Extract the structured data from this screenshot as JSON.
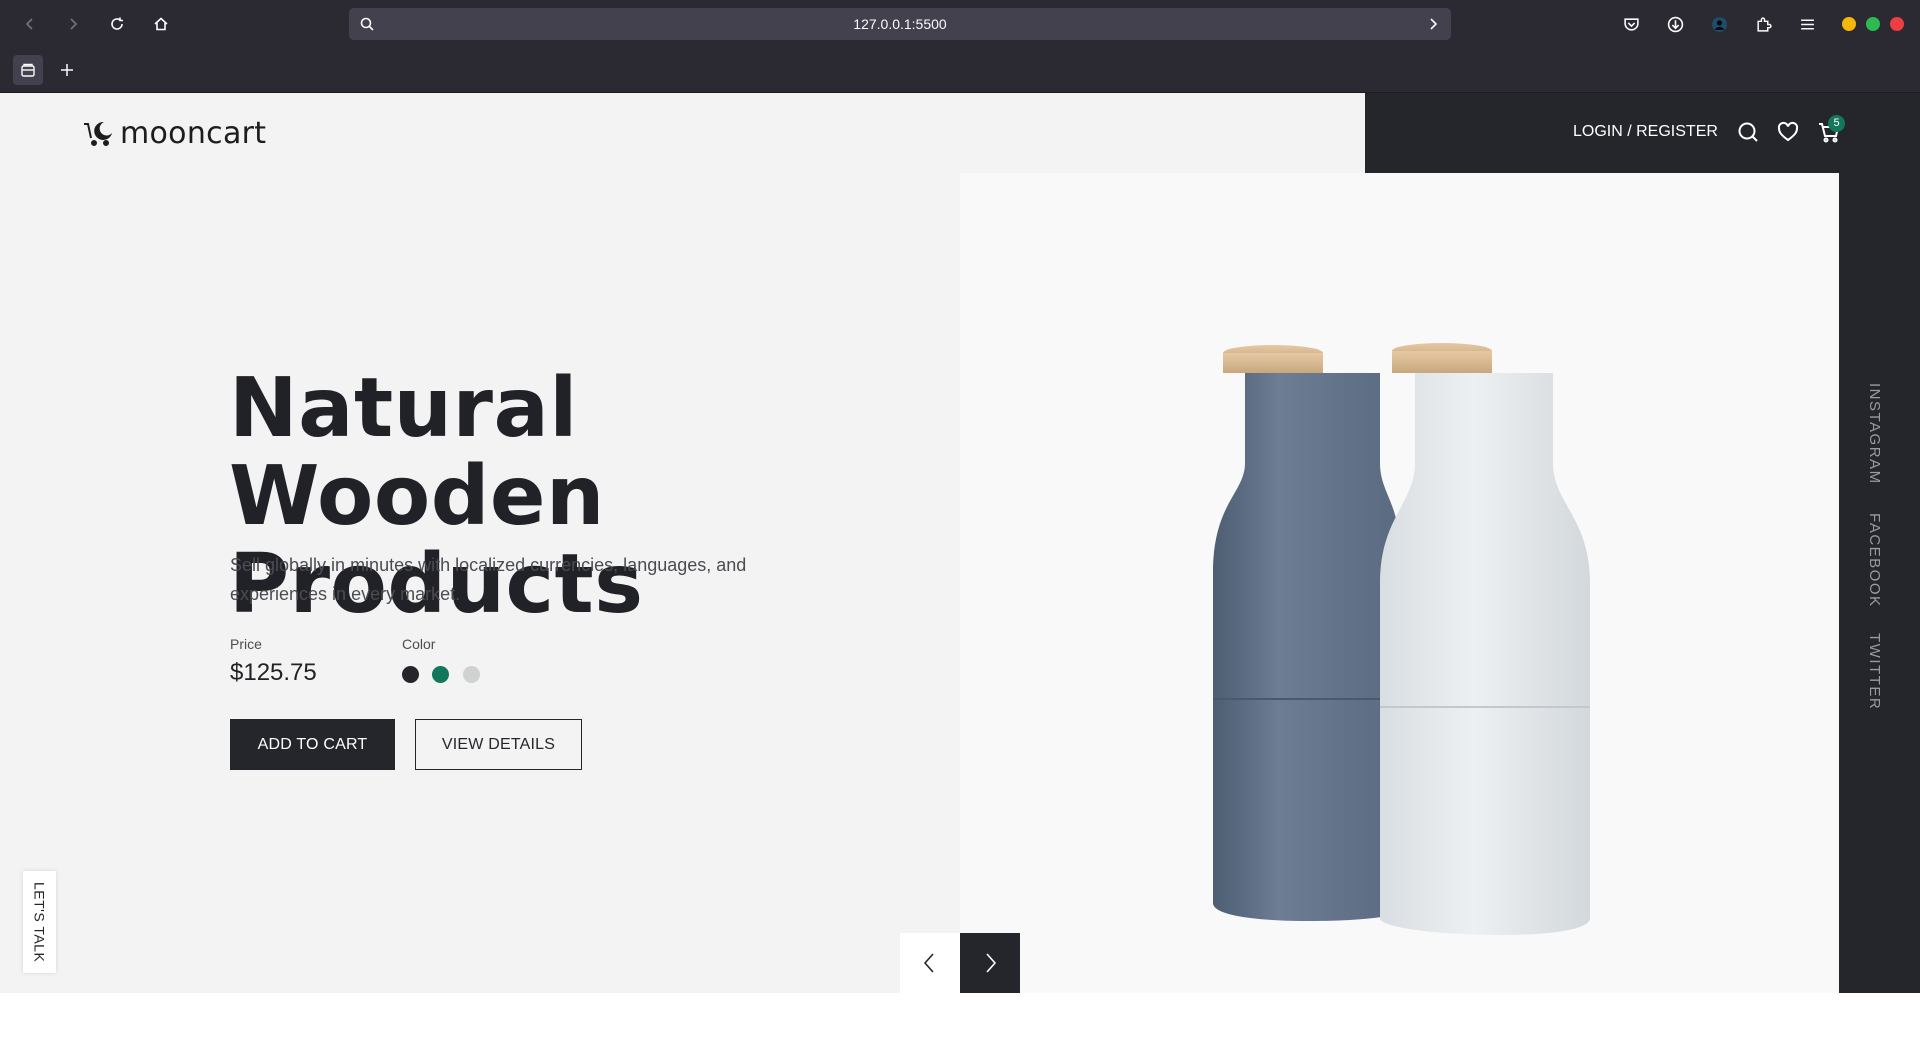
{
  "browser": {
    "url": "127.0.0.1:5500",
    "icons": [
      "back-icon",
      "forward-icon",
      "reload-icon",
      "home-icon",
      "search-icon",
      "pocket-icon",
      "download-icon",
      "account-icon",
      "extensions-icon",
      "menu-icon",
      "tab-icon",
      "new-tab-icon"
    ],
    "window_colors": [
      "#f5b70a",
      "#2dbb4f",
      "#ee3e44"
    ]
  },
  "site": {
    "logo_text": "mooncart",
    "login_label": "LOGIN / REGISTER",
    "cart_count": "5",
    "hero": {
      "title_line1": "Natural Wooden",
      "title_line2": "Products",
      "description": "Sell globally in minutes with localized currencies, languages, and experiences in every market.",
      "price_label": "Price",
      "price": "$125.75",
      "color_label": "Color",
      "colors": [
        "#25262b",
        "#13775e",
        "#cfd2d0"
      ],
      "add_to_cart": "ADD TO CART",
      "view_details": "VIEW DETAILS"
    },
    "social": [
      "INSTAGRAM",
      "FACEBOOK",
      "TWITTER"
    ],
    "lets_talk": "LET'S TALK",
    "theme": {
      "dark": "#25262b",
      "accent": "#13775e"
    }
  }
}
